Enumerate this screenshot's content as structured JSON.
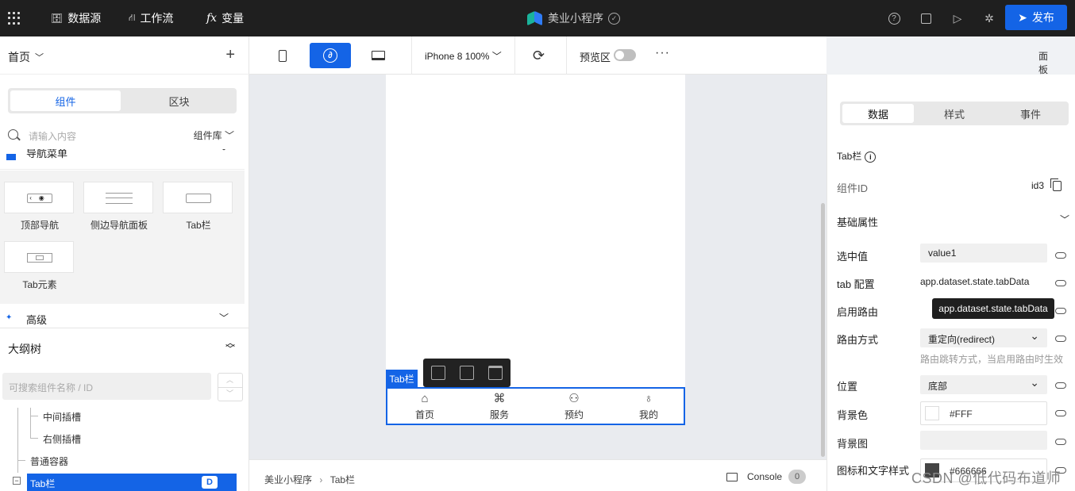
{
  "topbar": {
    "datasource": "数据源",
    "workflow": "工作流",
    "variable": "变量",
    "app_title": "美业小程序",
    "publish": "发布"
  },
  "left": {
    "page_title": "首页",
    "seg": [
      "组件",
      "区块"
    ],
    "search_placeholder": "请输入内容",
    "library": "组件库",
    "nav_group": "导航菜单",
    "components": [
      "顶部导航",
      "侧边导航面板",
      "Tab栏",
      "Tab元素"
    ],
    "advanced": "高级",
    "outline": "大纲树",
    "tree_search_placeholder": "可搜索组件名称 / ID",
    "tree": [
      "中间插槽",
      "右侧插槽",
      "普通容器"
    ],
    "tree_selected": "Tab栏",
    "tree_selected_badge": "D"
  },
  "toolbar": {
    "device": "iPhone 8 100%",
    "preview": "预览区",
    "panel": "面板"
  },
  "canvas": {
    "tag": "Tab栏",
    "tabs": [
      {
        "label": "首页",
        "icon": "home-icon"
      },
      {
        "label": "服务",
        "icon": "apps-icon"
      },
      {
        "label": "预约",
        "icon": "person-icon"
      },
      {
        "label": "我的",
        "icon": "user-icon"
      }
    ]
  },
  "status": {
    "crumb_app": "美业小程序",
    "crumb_page": "Tab栏",
    "console": "Console",
    "console_count": "0"
  },
  "right": {
    "tabs": [
      "数据",
      "样式",
      "事件"
    ],
    "component_title": "Tab栏",
    "component_id_label": "组件ID",
    "component_id": "id3",
    "section": "基础属性",
    "selected_value_label": "选中值",
    "selected_value": "value1",
    "tab_config_label": "tab 配置",
    "tab_config": "app.dataset.state.tabData",
    "route_enable_label": "启用路由",
    "tooltip": "app.dataset.state.tabData",
    "route_mode_label": "路由方式",
    "route_mode": "重定向(redirect)",
    "route_hint": "路由跳转方式，当启用路由时生效",
    "position_label": "位置",
    "position": "底部",
    "bg_color_label": "背景色",
    "bg_color": "#FFF",
    "bg_image_label": "背景图",
    "icon_text_label": "图标和文字样式",
    "icon_text_value": "#666666"
  },
  "watermark": "CSDN @低代码布道师"
}
